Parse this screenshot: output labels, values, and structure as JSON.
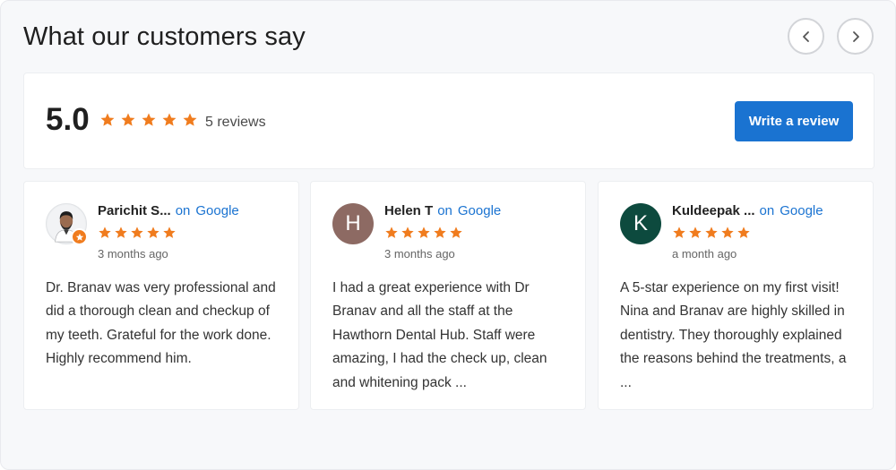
{
  "header": {
    "title": "What our customers say"
  },
  "colors": {
    "star": "#f07c1e",
    "link": "#1a73d1",
    "button_bg": "#1a73d1"
  },
  "icons": {
    "prev": "chevron-left-icon",
    "next": "chevron-right-icon",
    "star": "star-icon"
  },
  "summary": {
    "score": "5.0",
    "stars": 5,
    "count_label": "5 reviews",
    "write_review_label": "Write a review"
  },
  "reviews": [
    {
      "name": "Parichit S...",
      "on_label": "on",
      "source": "Google",
      "stars": 5,
      "time": "3 months ago",
      "text": "Dr. Branav was very professional and did a thorough clean and checkup of my teeth. Grateful for the work done. Highly recommend him.",
      "avatar_type": "photo"
    },
    {
      "name": "Helen T",
      "on_label": "on",
      "source": "Google",
      "stars": 5,
      "time": "3 months ago",
      "text": "I had a great experience with Dr Branav and all the staff at the Hawthorn Dental Hub. Staff were amazing, I had the check up, clean and whitening pack ...",
      "avatar_initial": "H",
      "avatar_color": "#8d6a63"
    },
    {
      "name": "Kuldeepak ...",
      "on_label": "on",
      "source": "Google",
      "stars": 5,
      "time": "a month ago",
      "text": "A 5-star experience on my first visit! Nina and Branav are highly skilled in dentistry. They thoroughly explained the reasons behind the treatments, a ...",
      "avatar_initial": "K",
      "avatar_color": "#0d4a3e"
    }
  ]
}
